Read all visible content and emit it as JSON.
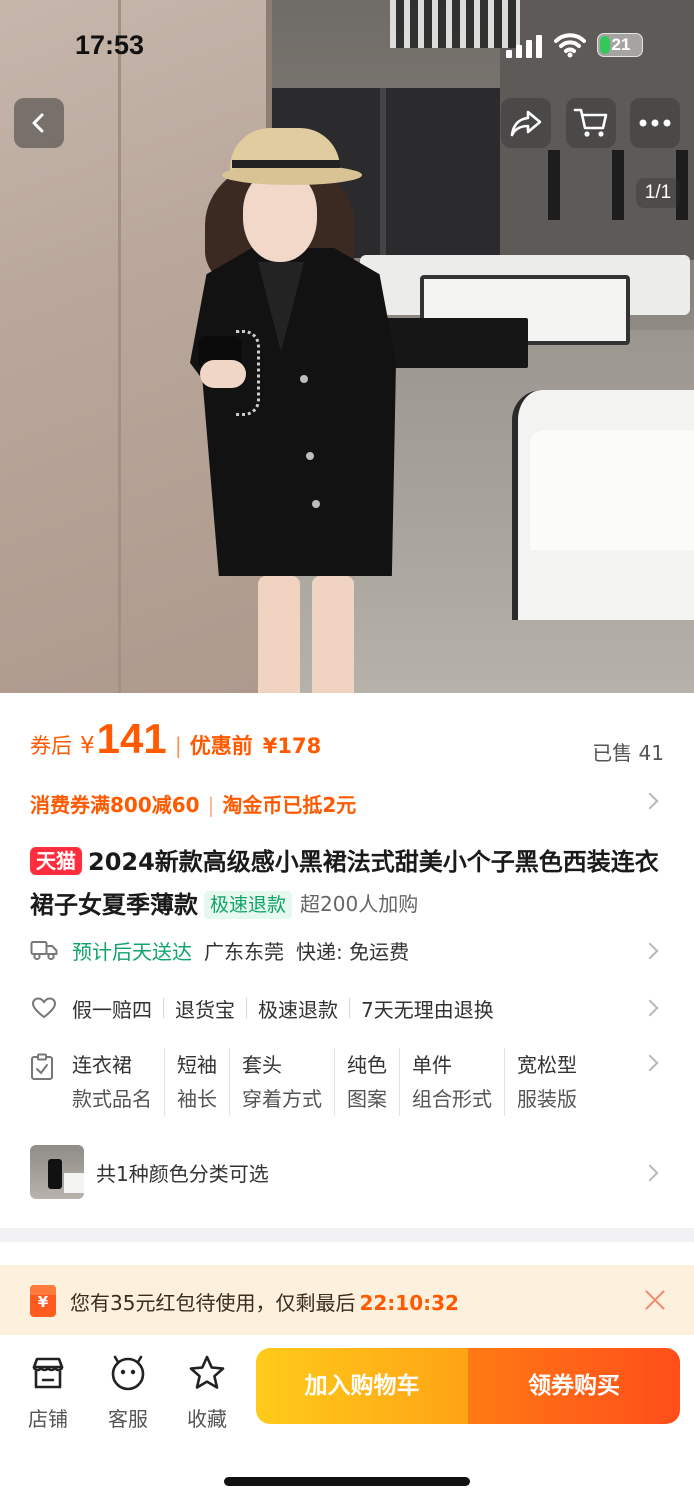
{
  "status_bar": {
    "time": "17:53",
    "battery": "21"
  },
  "gallery": {
    "page_indicator": "1/1"
  },
  "price": {
    "after_coupon_label": "券后",
    "currency": "¥",
    "after_coupon_value": "141",
    "before_label": "优惠前",
    "before_value": "¥178",
    "sold": "已售 41"
  },
  "coupons": {
    "voucher": "消费券满800减60",
    "coins": "淘金币已抵2元"
  },
  "product": {
    "badge": "天猫",
    "title": "2024新款高级感小黑裙法式甜美小个子黑色西装连衣裙子女夏季薄款",
    "fast_refund_tag": "极速退款",
    "cart_count_tag": "超200人加购"
  },
  "delivery": {
    "eta": "预计后天送达",
    "origin": "广东东莞",
    "shipping": "快递: 免运费"
  },
  "services": [
    "假一赔四",
    "退货宝",
    "极速退款",
    "7天无理由退换"
  ],
  "attributes": [
    {
      "value": "连衣裙",
      "key": "款式品名"
    },
    {
      "value": "短袖",
      "key": "袖长"
    },
    {
      "value": "套头",
      "key": "穿着方式"
    },
    {
      "value": "纯色",
      "key": "图案"
    },
    {
      "value": "单件",
      "key": "组合形式"
    },
    {
      "value": "宽松型",
      "key": "服装版"
    }
  ],
  "sku": {
    "text": "共1种颜色分类可选"
  },
  "red_packet": {
    "text": "您有35元红包待使用，仅剩最后",
    "countdown": "22:10:32"
  },
  "bottom_bar": {
    "shop": "店铺",
    "service": "客服",
    "favorite": "收藏",
    "add_to_cart": "加入购物车",
    "buy_with_coupon": "领券购买"
  },
  "colors": {
    "accent_orange": "#ff5a00",
    "tmall_red": "#ff2d3d",
    "green": "#10a36a"
  }
}
